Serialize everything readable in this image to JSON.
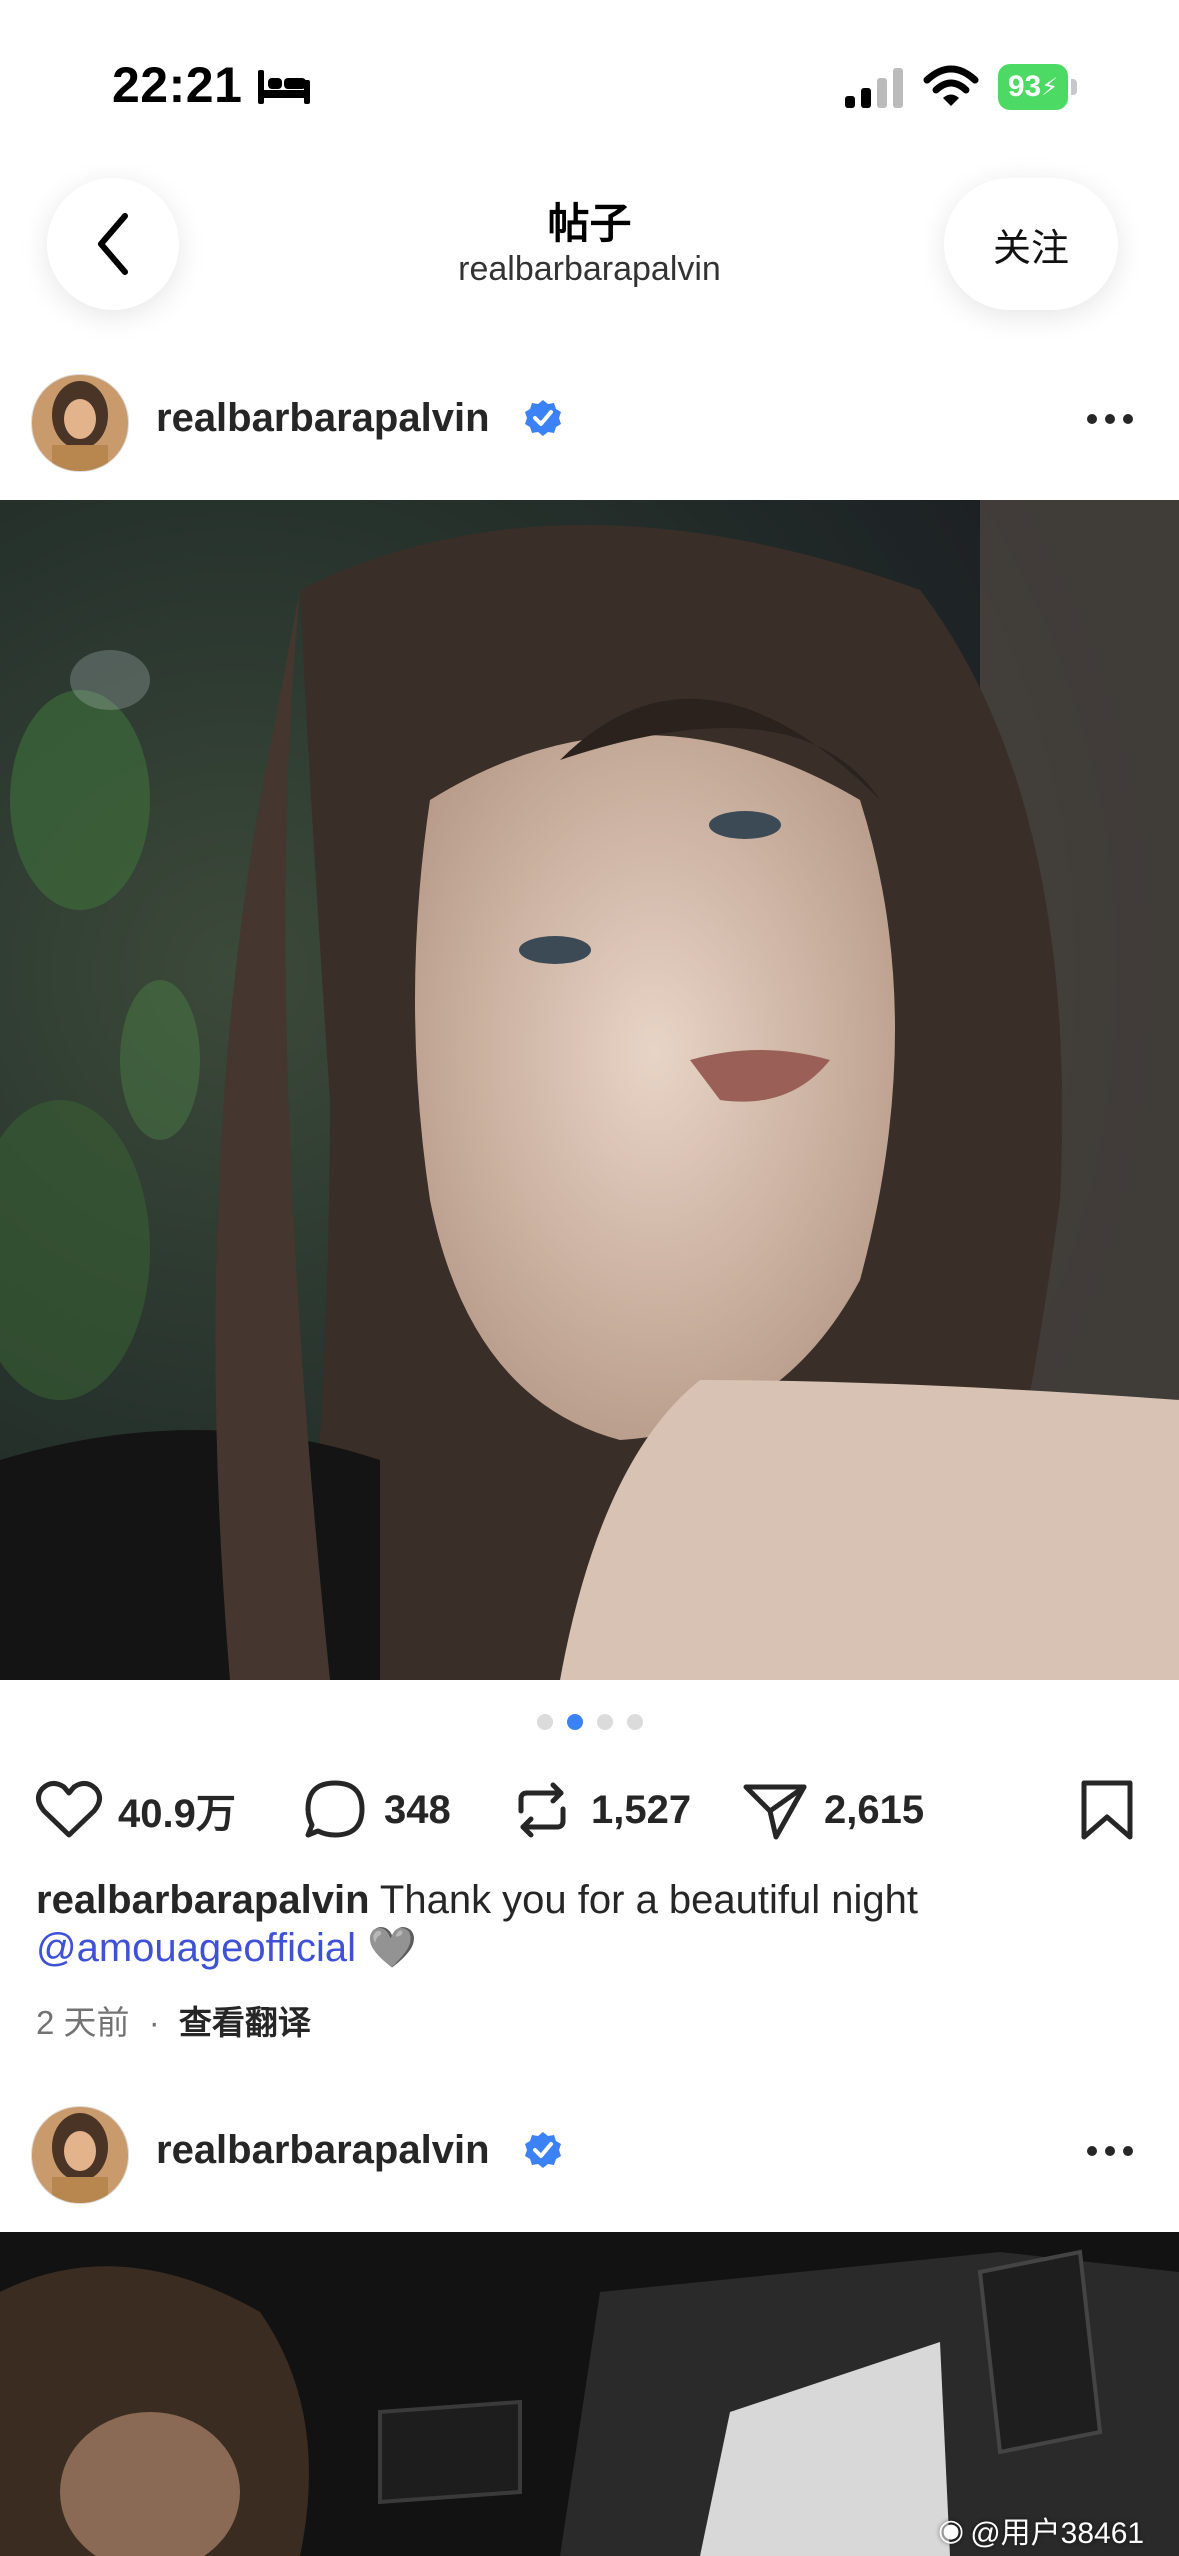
{
  "status_bar": {
    "time": "22:21",
    "battery_percent": "93"
  },
  "header": {
    "title": "帖子",
    "subtitle": "realbarbarapalvin",
    "follow_label": "关注"
  },
  "post1": {
    "username": "realbarbarapalvin",
    "carousel": {
      "count": 4,
      "active_index": 1
    },
    "likes": "40.9万",
    "comments": "348",
    "reposts": "1,527",
    "shares": "2,615",
    "caption_text": "Thank you for a beautiful night",
    "caption_mention": "@amouageofficial",
    "caption_emoji": "🩶",
    "time_ago": "2 天前",
    "separator": "·",
    "translate_label": "查看翻译"
  },
  "post2": {
    "username": "realbarbarapalvin"
  },
  "watermark": {
    "text": "@用户38461"
  },
  "colors": {
    "accent": "#3b82f6",
    "mention": "#3f51d6",
    "battery": "#4cd964"
  }
}
